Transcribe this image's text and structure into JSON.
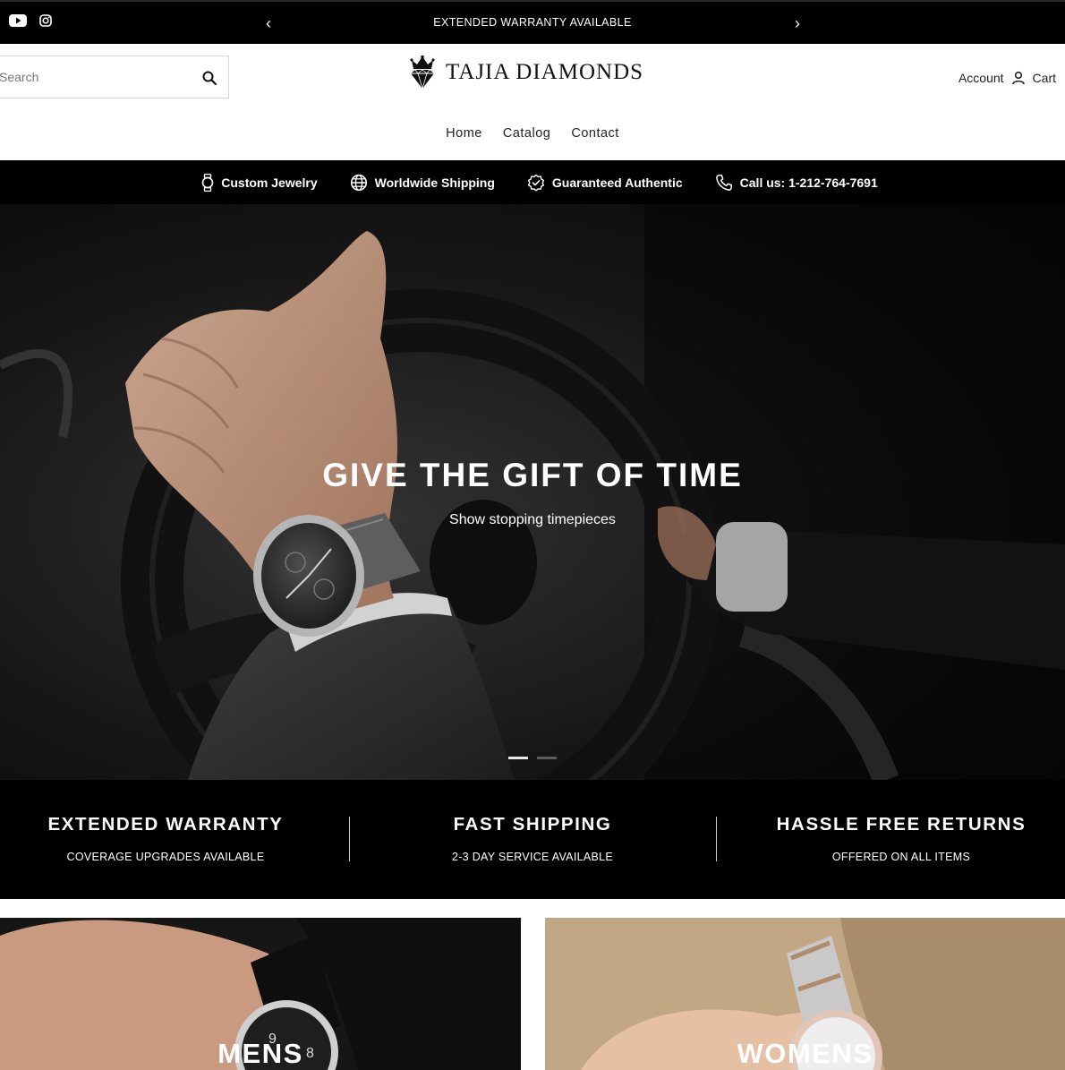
{
  "announcement": {
    "social": [
      "youtube-icon",
      "instagram-icon"
    ],
    "message": "EXTENDED WARRANTY AVAILABLE",
    "prev": "‹",
    "next": "›"
  },
  "header": {
    "search_placeholder": "Search",
    "logo_text": "TAJIA DIAMONDS",
    "account_label": "Account",
    "cart_label": "Cart",
    "nav": [
      "Home",
      "Catalog",
      "Contact"
    ]
  },
  "features": [
    {
      "icon": "watch-icon",
      "label": "Custom Jewelry"
    },
    {
      "icon": "globe-icon",
      "label": "Worldwide Shipping"
    },
    {
      "icon": "verified-badge-icon",
      "label": "Guaranteed Authentic"
    },
    {
      "icon": "phone-icon",
      "label": "Call us: 1-212-764-7691"
    }
  ],
  "hero": {
    "title": "GIVE THE GIFT OF TIME",
    "subtitle": "Show stopping timepieces",
    "slides": 2,
    "active_slide": 1
  },
  "benefits": [
    {
      "title": "EXTENDED WARRANTY",
      "subtitle": "COVERAGE UPGRADES AVAILABLE"
    },
    {
      "title": "FAST SHIPPING",
      "subtitle": "2-3 DAY SERVICE AVAILABLE"
    },
    {
      "title": "HASSLE FREE RETURNS",
      "subtitle": "OFFERED ON ALL ITEMS"
    }
  ],
  "collections": [
    {
      "label": "MENS"
    },
    {
      "label": "WOMENS"
    }
  ],
  "colors": {
    "bar_background": "#000000",
    "page_background": "#ffffff",
    "text_primary": "#111111"
  }
}
